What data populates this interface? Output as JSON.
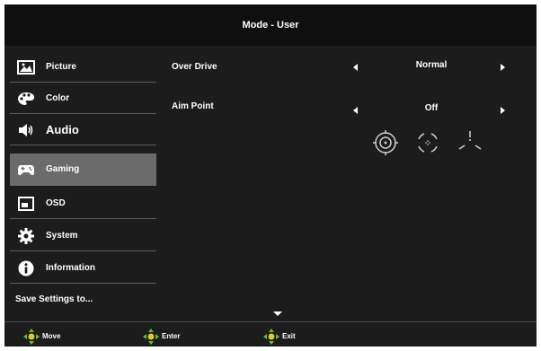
{
  "header": {
    "title": "Mode - User"
  },
  "sidebar": {
    "items": [
      {
        "label": "Picture",
        "icon": "picture-icon",
        "selected": false
      },
      {
        "label": "Color",
        "icon": "palette-icon",
        "selected": false
      },
      {
        "label": "Audio",
        "icon": "speaker-icon",
        "selected": false
      },
      {
        "label": "Gaming",
        "icon": "gamepad-icon",
        "selected": true
      },
      {
        "label": "OSD",
        "icon": "osd-window-icon",
        "selected": false
      },
      {
        "label": "System",
        "icon": "gear-icon",
        "selected": false
      },
      {
        "label": "Information",
        "icon": "info-icon",
        "selected": false
      }
    ],
    "save_label": "Save Settings to..."
  },
  "options": [
    {
      "label": "Over Drive",
      "value": "Normal"
    },
    {
      "label": "Aim Point",
      "value": "Off"
    }
  ],
  "aim_point_styles": [
    "crosshair-circle-icon",
    "dot-circle-icon",
    "tri-line-icon"
  ],
  "footer": {
    "move_label": "Move",
    "enter_label": "Enter",
    "exit_label": "Exit"
  },
  "colors": {
    "panel_bg": "#1c1c1c",
    "header_bg": "#0f0f0f",
    "selected_bg": "#6b6b6b",
    "footer_icon_green": "#58c23c",
    "footer_icon_yellow": "#e8c52a"
  }
}
